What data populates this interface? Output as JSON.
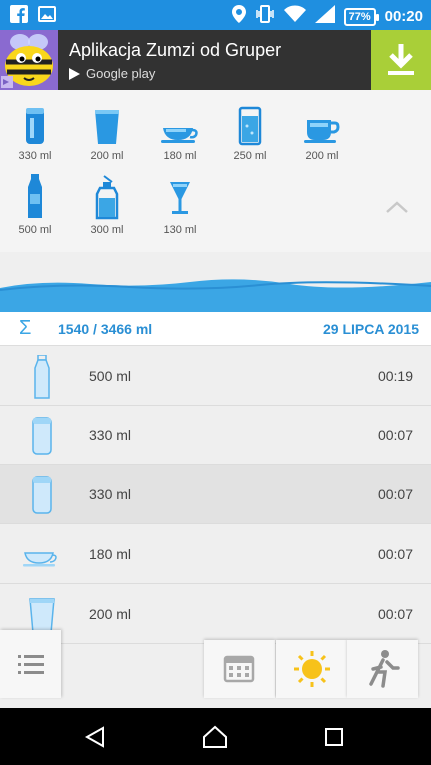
{
  "status_bar": {
    "battery": "77%",
    "time": "00:20",
    "icons": [
      "facebook-icon",
      "image-icon",
      "location-icon",
      "vibrate-icon",
      "wifi-icon",
      "signal-icon",
      "battery-icon"
    ]
  },
  "ad": {
    "title": "Aplikacja Zumzi od Gruper",
    "store": "Google play",
    "icons": [
      "bee-logo-icon",
      "play-store-icon",
      "download-icon",
      "ad-choices-icon"
    ]
  },
  "drinks": [
    {
      "label": "330 ml",
      "icon": "can-icon"
    },
    {
      "label": "200 ml",
      "icon": "cup-icon"
    },
    {
      "label": "180 ml",
      "icon": "teacup-icon"
    },
    {
      "label": "250 ml",
      "icon": "glass-icon"
    },
    {
      "label": "200 ml",
      "icon": "mug-icon"
    },
    {
      "label": "500 ml",
      "icon": "bottle-icon"
    },
    {
      "label": "300 ml",
      "icon": "sport-bottle-icon"
    },
    {
      "label": "130 ml",
      "icon": "wine-glass-icon"
    }
  ],
  "summary": {
    "total": "1540 / 3466 ml",
    "date": "29 LIPCA 2015",
    "progress_fraction": 0.444
  },
  "entries": [
    {
      "volume": "500 ml",
      "time": "00:19",
      "icon": "bottle-icon"
    },
    {
      "volume": "330 ml",
      "time": "00:07",
      "icon": "can-icon"
    },
    {
      "volume": "330 ml",
      "time": "00:07",
      "icon": "can-icon"
    },
    {
      "volume": "180 ml",
      "time": "00:07",
      "icon": "teacup-icon"
    },
    {
      "volume": "200 ml",
      "time": "00:07",
      "icon": "cup-icon"
    }
  ],
  "toolbar": {
    "icons": [
      "menu-icon",
      "calendar-icon",
      "sun-icon",
      "runner-icon"
    ]
  },
  "nav": {
    "icons": [
      "back-icon",
      "home-icon",
      "recents-icon"
    ]
  },
  "colors": {
    "status_bar": "#1f8fe0",
    "accent": "#2a8fd4",
    "water": "#3ba6e5",
    "ad_download": "#a9cf38",
    "sun": "#f7c21a"
  }
}
